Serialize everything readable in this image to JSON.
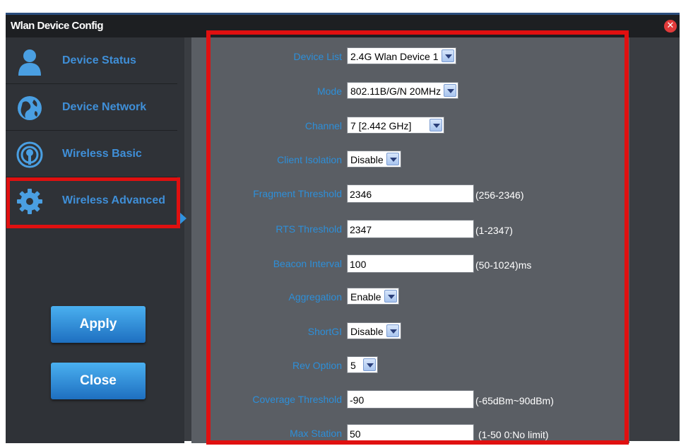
{
  "window": {
    "title": "Wlan Device Config"
  },
  "sidebar": {
    "items": [
      {
        "label": "Device Status",
        "icon": "user-icon"
      },
      {
        "label": "Device Network",
        "icon": "globe-icon"
      },
      {
        "label": "Wireless Basic",
        "icon": "wireless-icon"
      },
      {
        "label": "Wireless Advanced",
        "icon": "gear-icon",
        "active": true
      }
    ],
    "apply_label": "Apply",
    "close_label": "Close"
  },
  "form": {
    "device_list": {
      "label": "Device List",
      "value": "2.4G Wlan Device 1"
    },
    "mode": {
      "label": "Mode",
      "value": "802.11B/G/N 20MHz"
    },
    "channel": {
      "label": "Channel",
      "value": "7 [2.442 GHz]"
    },
    "client_isolation": {
      "label": "Client Isolation",
      "value": "Disable"
    },
    "fragment_threshold": {
      "label": "Fragment Threshold",
      "value": "2346",
      "hint": "(256-2346)"
    },
    "rts_threshold": {
      "label": "RTS Threshold",
      "value": "2347",
      "hint": "(1-2347)"
    },
    "beacon_interval": {
      "label": "Beacon Interval",
      "value": "100",
      "hint": "(50-1024)ms"
    },
    "aggregation": {
      "label": "Aggregation",
      "value": "Enable"
    },
    "short_gi": {
      "label": "ShortGI",
      "value": "Disable"
    },
    "rev_option": {
      "label": "Rev Option",
      "value": "5"
    },
    "coverage_threshold": {
      "label": "Coverage Threshold",
      "value": "-90",
      "hint": "(-65dBm~90dBm)"
    },
    "max_station": {
      "label": "Max Station",
      "value": "50",
      "hint": "(1-50 0:No limit)"
    }
  },
  "colors": {
    "accent": "#2d8fd9",
    "highlight": "#e01010",
    "panel": "#5a5e64",
    "sidebar": "#2f3237"
  }
}
